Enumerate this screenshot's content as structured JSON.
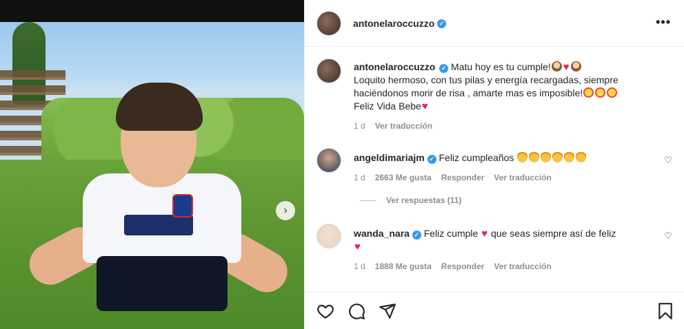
{
  "post": {
    "username": "antonelaroccuzzo",
    "more_label": "•••"
  },
  "caption": {
    "username": "antonelaroccuzzo",
    "line1": "Matu hoy es tu cumple!",
    "line2": "Loquito hermoso, con tus pilas y energía recargadas, siempre haciéndonos morir de risa , amarte mas es imposible!",
    "line3": "Feliz Vida Bebe",
    "time": "1 d",
    "translate": "Ver traducción"
  },
  "comments": [
    {
      "username": "angeldimariajm",
      "text": "Feliz cumpleaños",
      "time": "1 d",
      "likes": "2663 Me gusta",
      "reply": "Responder",
      "translate": "Ver traducción",
      "view_replies": "Ver respuestas (11)"
    },
    {
      "username": "wanda_nara",
      "text_a": "Feliz cumple",
      "text_b": "que seas siempre así de feliz",
      "time": "1 d",
      "likes": "1888 Me gusta",
      "reply": "Responder",
      "translate": "Ver traducción"
    }
  ],
  "icons": [
    "heart-icon",
    "comment-icon",
    "share-icon",
    "bookmark-icon",
    "verified-icon",
    "chevron-right-icon"
  ],
  "colors": {
    "verified": "#3897f0",
    "heart": "#e0245e",
    "muted": "#8e8e8e"
  }
}
